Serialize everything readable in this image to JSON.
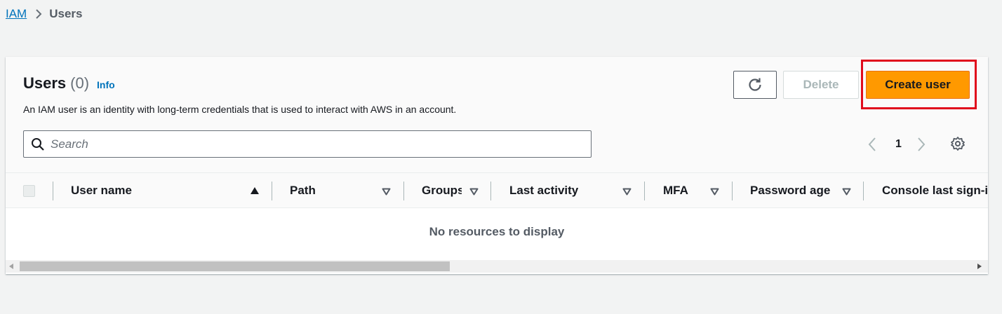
{
  "breadcrumb": {
    "root": "IAM",
    "current": "Users"
  },
  "header": {
    "title": "Users",
    "count": "(0)",
    "info": "Info",
    "description": "An IAM user is an identity with long-term credentials that is used to interact with AWS in an account."
  },
  "actions": {
    "refresh_icon": "refresh-icon",
    "delete_label": "Delete",
    "create_label": "Create user"
  },
  "search": {
    "placeholder": "Search",
    "value": ""
  },
  "pagination": {
    "current_page": "1"
  },
  "table": {
    "columns": [
      "User name",
      "Path",
      "Groups",
      "Last activity",
      "MFA",
      "Password age",
      "Console last sign-in"
    ],
    "sorted_column": "User name",
    "empty_message": "No resources to display"
  },
  "colors": {
    "accent": "#ff9900",
    "link": "#0073bb",
    "highlight": "#e00b1c"
  }
}
